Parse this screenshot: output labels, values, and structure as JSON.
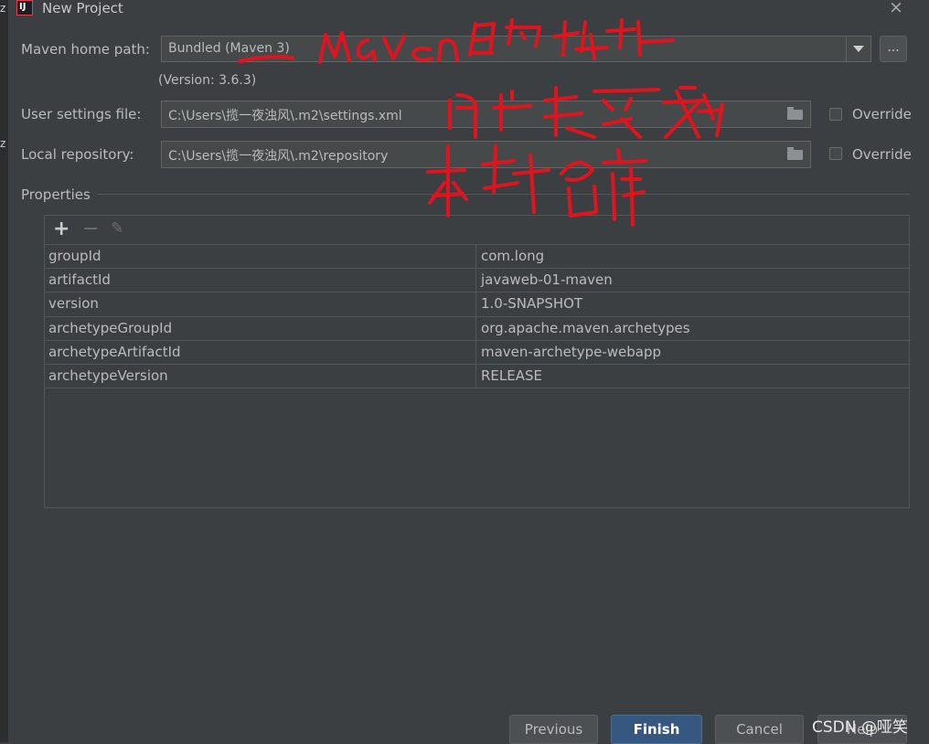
{
  "window": {
    "title": "New Project",
    "app_icon": "IJ",
    "close_icon": "×"
  },
  "left_strip_chars": [
    "z",
    "z"
  ],
  "maven": {
    "home_label": "Maven home path:",
    "home_value": "Bundled (Maven 3)",
    "browse_label": "...",
    "version": "(Version: 3.6.3)",
    "settings_label": "User settings file:",
    "settings_value": "C:\\Users\\揽一夜浊风\\.m2\\settings.xml",
    "repo_label": "Local repository:",
    "repo_value": "C:\\Users\\揽一夜浊风\\.m2\\repository",
    "override_label": "Override"
  },
  "properties": {
    "title": "Properties",
    "toolbar": {
      "add": "+",
      "remove": "−",
      "edit": "✎"
    },
    "rows": [
      {
        "key": "groupId",
        "value": "com.long"
      },
      {
        "key": "artifactId",
        "value": "javaweb-01-maven"
      },
      {
        "key": "version",
        "value": "1.0-SNAPSHOT"
      },
      {
        "key": "archetypeGroupId",
        "value": "org.apache.maven.archetypes"
      },
      {
        "key": "archetypeArtifactId",
        "value": "maven-archetype-webapp"
      },
      {
        "key": "archetypeVersion",
        "value": "RELEASE"
      }
    ]
  },
  "buttons": {
    "previous": "Previous",
    "finish": "Finish",
    "cancel": "Cancel",
    "help": "Help"
  },
  "watermark": "CSDN @哑笑",
  "colors": {
    "annotation": "#e0141e",
    "primary_button": "#365880",
    "background": "#3c3f41"
  }
}
